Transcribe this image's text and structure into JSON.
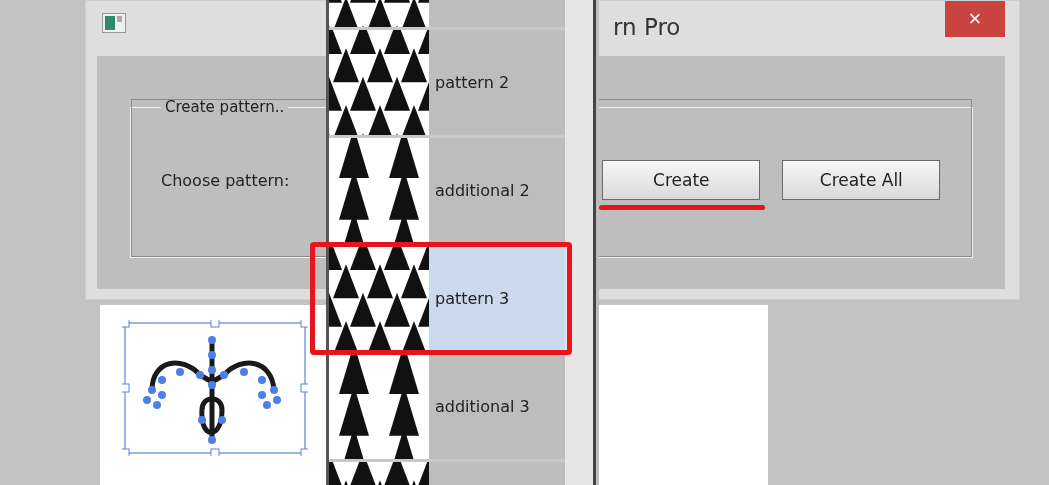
{
  "window": {
    "title": "rn Pro",
    "close": "×"
  },
  "group": {
    "legend": "Create pattern..",
    "label": "Choose pattern:"
  },
  "buttons": [
    {
      "label": "Create",
      "underlined": true
    },
    {
      "label": "Create All",
      "underlined": false
    }
  ],
  "dropdown": {
    "items": [
      {
        "label": "pattern 2",
        "selected": false,
        "annotated": false
      },
      {
        "label": "additional 2",
        "selected": false,
        "annotated": false
      },
      {
        "label": "pattern 3",
        "selected": true,
        "annotated": true
      },
      {
        "label": "additional 3",
        "selected": false,
        "annotated": false
      }
    ]
  }
}
